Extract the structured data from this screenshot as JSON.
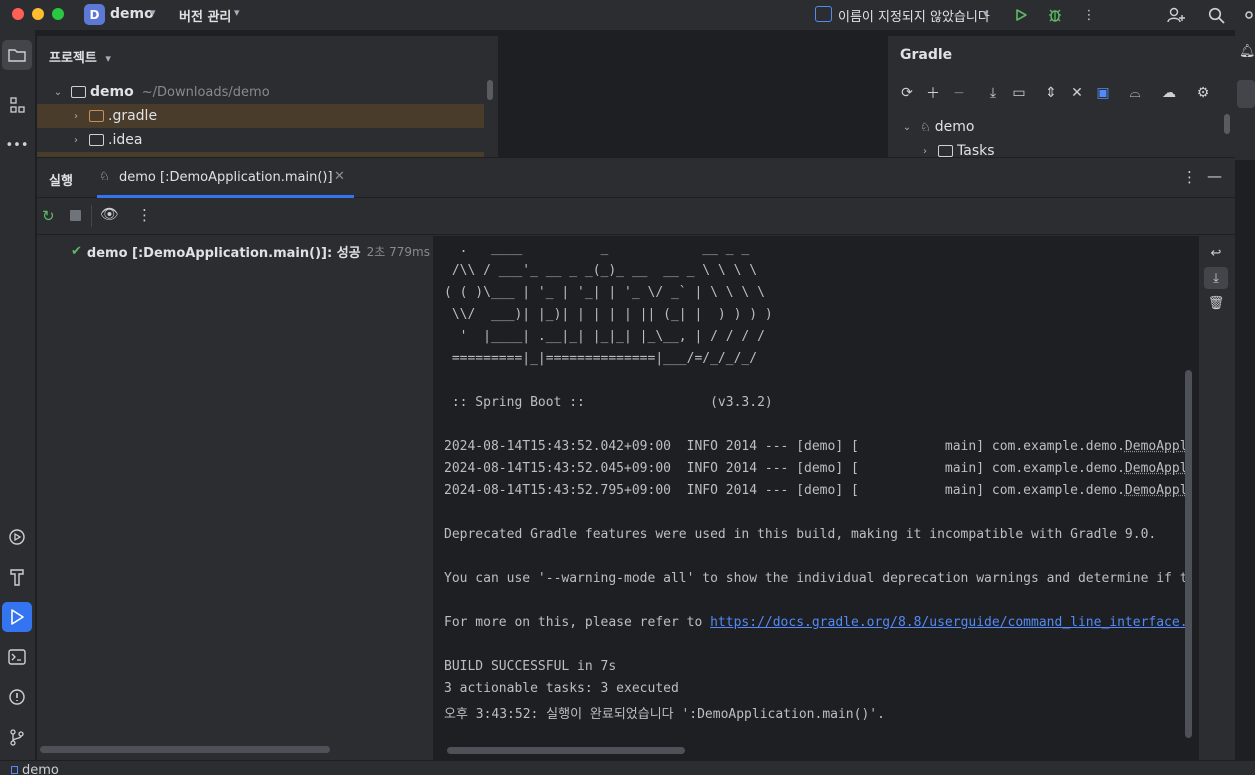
{
  "titlebar": {
    "project_badge": "D",
    "project_name": "demo",
    "vcs_label": "버전 관리",
    "run_config": "이름이 지정되지 않았습니다"
  },
  "project_panel": {
    "title": "프로젝트",
    "tree": [
      {
        "name": "demo",
        "path": "~/Downloads/demo"
      },
      {
        "name": ".gradle"
      },
      {
        "name": ".idea"
      }
    ]
  },
  "gradle_panel": {
    "title": "Gradle",
    "tree": [
      {
        "name": "demo"
      },
      {
        "name": "Tasks"
      }
    ]
  },
  "run_window": {
    "label": "실행",
    "tab_title": "demo [:DemoApplication.main()]",
    "tree_item": "demo [:DemoApplication.main()]: 성공",
    "tree_item_time": "2초 779ms"
  },
  "console": {
    "banner": [
      "  .   ____          _            __ _ _",
      " /\\\\ / ___'_ __ _ _(_)_ __  __ _ \\ \\ \\ \\",
      "( ( )\\___ | '_ | '_| | '_ \\/ _` | \\ \\ \\ \\",
      " \\\\/  ___)| |_)| | | | | || (_| |  ) ) ) )",
      "  '  |____| .__|_| |_|_| |_\\__, | / / / /",
      " =========|_|==============|___/=/_/_/_/"
    ],
    "spring_line": " :: Spring Boot ::                (v3.3.2)",
    "log_lines": [
      {
        "prefix": "2024-08-14T15:43:52.042+09:00  INFO 2014 --- [demo] [           main] com.example.demo.",
        "cls": "DemoAppl"
      },
      {
        "prefix": "2024-08-14T15:43:52.045+09:00  INFO 2014 --- [demo] [           main] com.example.demo.",
        "cls": "DemoAppl"
      },
      {
        "prefix": "2024-08-14T15:43:52.795+09:00  INFO 2014 --- [demo] [           main] com.example.demo.",
        "cls": "DemoAppl"
      }
    ],
    "deprecated": "Deprecated Gradle features were used in this build, making it incompatible with Gradle 9.0.",
    "warning_mode": "You can use '--warning-mode all' to show the individual deprecation warnings and determine if t",
    "more_info_prefix": "For more on this, please refer to ",
    "more_info_link": "https://docs.gradle.org/8.8/userguide/command_line_interface.",
    "build_success": "BUILD SUCCESSFUL in 7s",
    "tasks": "3 actionable tasks: 3 executed",
    "finished": "오후 3:43:52: 실행이 완료되었습니다 ':DemoApplication.main()'."
  },
  "statusbar": {
    "text": "demo"
  }
}
